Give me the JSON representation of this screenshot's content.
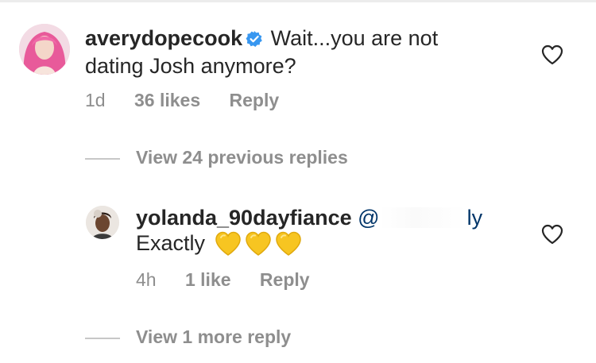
{
  "comment": {
    "username": "averydopecook",
    "verified": true,
    "text_line1": "Wait...you are not",
    "text_line2": "dating Josh anymore?",
    "time": "1d",
    "likes": "36 likes",
    "reply_label": "Reply"
  },
  "view_previous": {
    "label": "View 24 previous replies"
  },
  "reply": {
    "username": "yolanda_90dayfiance",
    "mention_prefix": "@",
    "mention_suffix": "ly",
    "text": "Exactly",
    "emoji": [
      "yellow-heart",
      "yellow-heart",
      "yellow-heart"
    ],
    "time": "4h",
    "likes": "1 like",
    "reply_label": "Reply"
  },
  "view_more": {
    "label": "View 1 more reply"
  },
  "colors": {
    "text": "#262626",
    "secondary": "#8e8e8e",
    "verified_blue": "#3897f0",
    "mention": "#003569",
    "heart_yellow": "#f5c518"
  }
}
